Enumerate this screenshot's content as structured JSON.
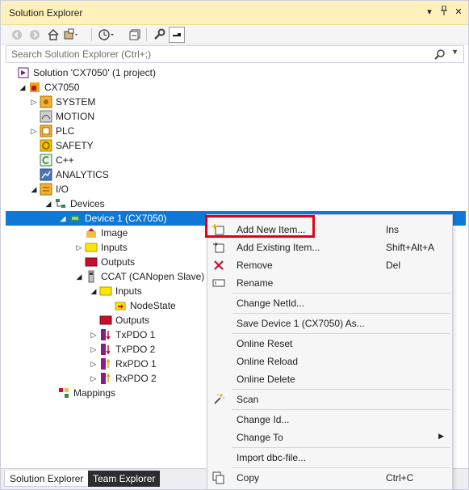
{
  "window": {
    "title": "Solution Explorer",
    "pin_glyph": "▾",
    "dock_glyph": "⊓",
    "close_glyph": "✕"
  },
  "toolbar": {
    "icons": [
      "back-icon",
      "forward-icon",
      "home-icon",
      "switch-views-icon",
      "history-icon",
      "collapse-all-icon",
      "properties-icon",
      "preview-icon"
    ]
  },
  "search": {
    "placeholder": "Search Solution Explorer (Ctrl+;)"
  },
  "tree": {
    "nodes": [
      {
        "label": "Solution 'CX7050' (1 project)",
        "icon": "solution-icon",
        "arrow": ""
      },
      {
        "label": "CX7050",
        "icon": "project-icon",
        "arrow": "◢"
      },
      {
        "label": "SYSTEM",
        "icon": "system-icon",
        "arrow": "▷"
      },
      {
        "label": "MOTION",
        "icon": "motion-icon",
        "arrow": ""
      },
      {
        "label": "PLC",
        "icon": "plc-icon",
        "arrow": "▷"
      },
      {
        "label": "SAFETY",
        "icon": "safety-icon",
        "arrow": ""
      },
      {
        "label": "C++",
        "icon": "cpp-icon",
        "arrow": ""
      },
      {
        "label": "ANALYTICS",
        "icon": "analytics-icon",
        "arrow": ""
      },
      {
        "label": "I/O",
        "icon": "io-icon",
        "arrow": "◢"
      },
      {
        "label": "Devices",
        "icon": "devices-icon",
        "arrow": "◢"
      },
      {
        "label": "Device 1 (CX7050)",
        "icon": "device-icon",
        "arrow": "◢"
      },
      {
        "label": "Image",
        "icon": "image-icon",
        "arrow": ""
      },
      {
        "label": "Inputs",
        "icon": "inputs-icon",
        "arrow": "▷"
      },
      {
        "label": "Outputs",
        "icon": "outputs-icon",
        "arrow": ""
      },
      {
        "label": "CCAT (CANopen Slave)",
        "icon": "ccat-icon",
        "arrow": "◢"
      },
      {
        "label": "Inputs",
        "icon": "inputs-icon",
        "arrow": "◢"
      },
      {
        "label": "NodeState",
        "icon": "variable-icon",
        "arrow": ""
      },
      {
        "label": "Outputs",
        "icon": "outputs-icon",
        "arrow": ""
      },
      {
        "label": "TxPDO 1",
        "icon": "txpdo-icon",
        "arrow": "▷"
      },
      {
        "label": "TxPDO 2",
        "icon": "txpdo-icon",
        "arrow": "▷"
      },
      {
        "label": "RxPDO 1",
        "icon": "rxpdo-icon",
        "arrow": "▷"
      },
      {
        "label": "RxPDO 2",
        "icon": "rxpdo-icon",
        "arrow": "▷"
      },
      {
        "label": "Mappings",
        "icon": "mappings-icon",
        "arrow": ""
      }
    ]
  },
  "tabs": {
    "solution_explorer": "Solution Explorer",
    "team_explorer": "Team Explorer"
  },
  "context_menu": {
    "items": [
      {
        "label": "Add New Item...",
        "shortcut": "Ins",
        "icon": "add-new-item-icon"
      },
      {
        "label": "Add Existing Item...",
        "shortcut": "Shift+Alt+A",
        "icon": "add-existing-item-icon"
      },
      {
        "label": "Remove",
        "shortcut": "Del",
        "icon": "remove-icon"
      },
      {
        "label": "Rename",
        "shortcut": "",
        "icon": "rename-icon"
      },
      {
        "label": "Change NetId...",
        "shortcut": "",
        "icon": ""
      },
      {
        "label": "Save Device 1 (CX7050) As...",
        "shortcut": "",
        "icon": ""
      },
      {
        "label": "Online Reset",
        "shortcut": "",
        "icon": ""
      },
      {
        "label": "Online Reload",
        "shortcut": "",
        "icon": ""
      },
      {
        "label": "Online Delete",
        "shortcut": "",
        "icon": ""
      },
      {
        "label": "Scan",
        "shortcut": "",
        "icon": "scan-icon"
      },
      {
        "label": "Change Id...",
        "shortcut": "",
        "icon": ""
      },
      {
        "label": "Change To",
        "shortcut": "",
        "icon": "",
        "submenu": "▶"
      },
      {
        "label": "Import dbc-file...",
        "shortcut": "",
        "icon": ""
      },
      {
        "label": "Copy",
        "shortcut": "Ctrl+C",
        "icon": "copy-icon"
      }
    ]
  },
  "colors": {
    "title_bar": "#fff1bd",
    "selection": "#0f78d7",
    "highlight_box": "#e2001a",
    "menu_bg": "#f6f6f6"
  }
}
